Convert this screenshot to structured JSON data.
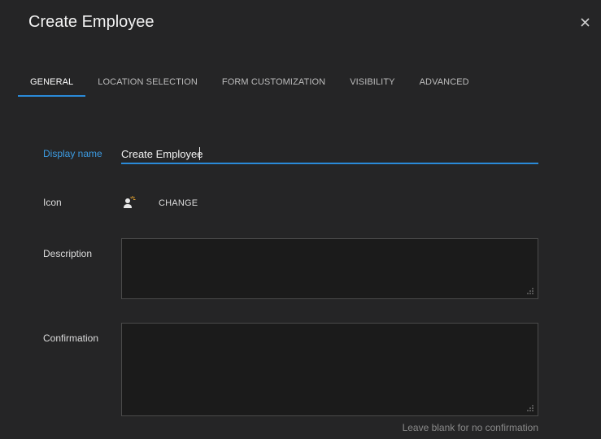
{
  "dialog": {
    "title": "Create Employee",
    "close_icon": "close-icon"
  },
  "tabs": [
    {
      "label": "GENERAL",
      "active": true
    },
    {
      "label": "LOCATION SELECTION",
      "active": false
    },
    {
      "label": "FORM CUSTOMIZATION",
      "active": false
    },
    {
      "label": "VISIBILITY",
      "active": false
    },
    {
      "label": "ADVANCED",
      "active": false
    }
  ],
  "form": {
    "display_name": {
      "label": "Display name",
      "value": "Create Employee"
    },
    "icon": {
      "label": "Icon",
      "icon_name": "person-add-icon",
      "change_label": "CHANGE"
    },
    "description": {
      "label": "Description",
      "value": ""
    },
    "confirmation": {
      "label": "Confirmation",
      "value": "",
      "hint": "Leave blank for no confirmation"
    }
  },
  "colors": {
    "accent": "#2a8ad8",
    "background": "#252526",
    "field_background": "#1b1b1b"
  }
}
